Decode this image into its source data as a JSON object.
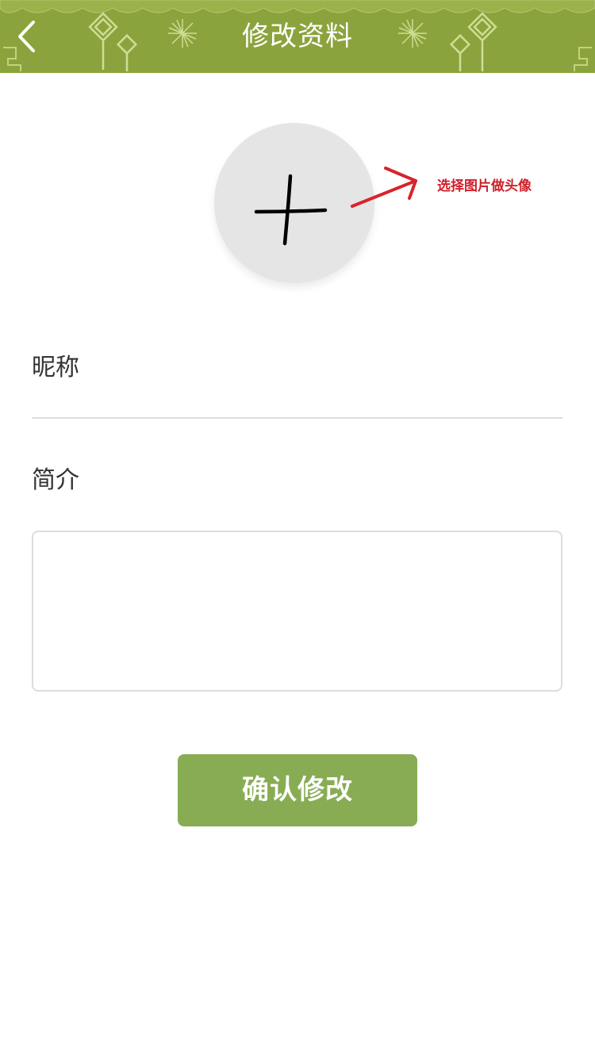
{
  "header": {
    "title": "修改资料",
    "back_icon": "chevron-left-icon",
    "background_color": "#8ba33c"
  },
  "avatar": {
    "icon": "plus-icon",
    "hint_text": "选择图片做头像",
    "hint_color": "#d0202a"
  },
  "form": {
    "nickname_label": "昵称",
    "nickname_value": "",
    "intro_label": "简介",
    "intro_value": ""
  },
  "actions": {
    "confirm_label": "确认修改",
    "confirm_color": "#88ac54"
  }
}
